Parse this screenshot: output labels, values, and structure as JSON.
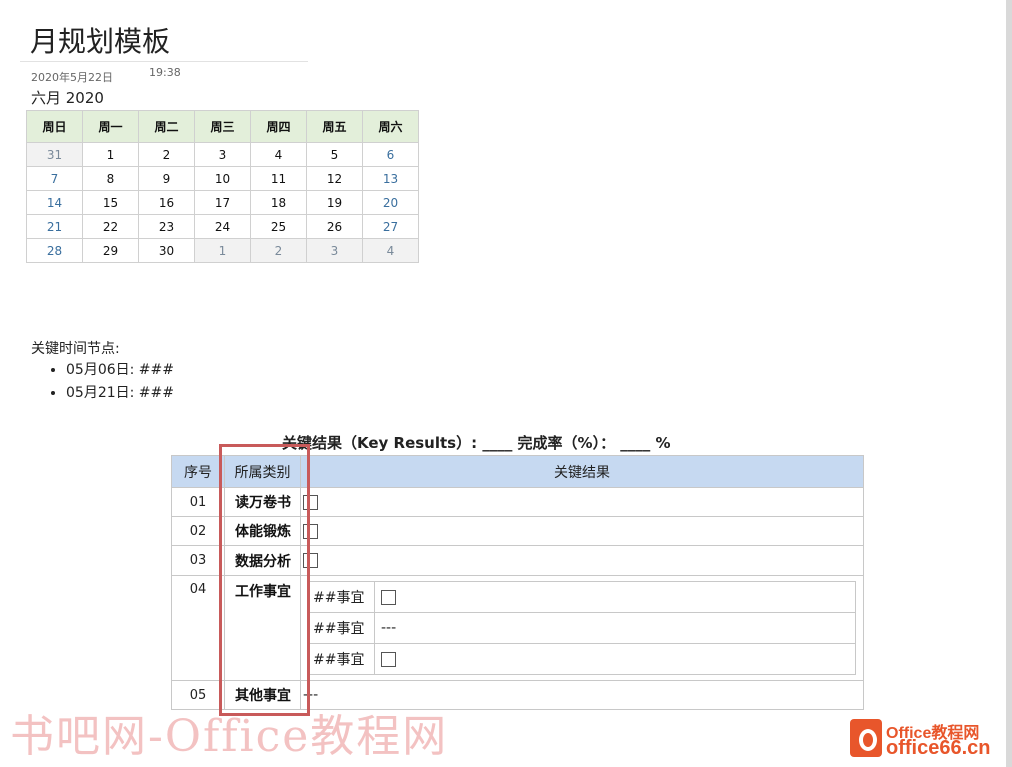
{
  "page": {
    "title": "月规划模板",
    "date": "2020年5月22日",
    "time": "19:38",
    "month": "六月 2020"
  },
  "calendar": {
    "headers": [
      "周日",
      "周一",
      "周二",
      "周三",
      "周四",
      "周五",
      "周六"
    ],
    "weeks": [
      [
        "31",
        "1",
        "2",
        "3",
        "4",
        "5",
        "6"
      ],
      [
        "7",
        "8",
        "9",
        "10",
        "11",
        "12",
        "13"
      ],
      [
        "14",
        "15",
        "16",
        "17",
        "18",
        "19",
        "20"
      ],
      [
        "21",
        "22",
        "23",
        "24",
        "25",
        "26",
        "27"
      ],
      [
        "28",
        "29",
        "30",
        "1",
        "2",
        "3",
        "4"
      ]
    ]
  },
  "key_times": {
    "label": "关键时间节点:",
    "items": [
      "05月06日: ###",
      "05月21日: ###"
    ]
  },
  "key_results": {
    "title": "关键结果（Key Results）:  ____  完成率（%）：   ____ %",
    "headers": [
      "序号",
      "所属类别",
      "关键结果"
    ],
    "rows": [
      {
        "num": "01",
        "cat": "读万卷书"
      },
      {
        "num": "02",
        "cat": "体能锻炼"
      },
      {
        "num": "03",
        "cat": "数据分析"
      },
      {
        "num": "04",
        "cat": "工作事宜"
      },
      {
        "num": "05",
        "cat": "其他事宜",
        "result": "---"
      }
    ],
    "sub_items": [
      {
        "label": "##事宜"
      },
      {
        "label": "##事宜",
        "value": "---"
      },
      {
        "label": "##事宜"
      }
    ]
  },
  "watermark": "书吧网-Office教程网",
  "logo": {
    "top": "Office教程网",
    "bottom": "office66.cn"
  },
  "colors": {
    "calendar_header_bg": "#e3efda",
    "table_header_bg": "#c6d9f1",
    "highlight_border": "#c85a5a",
    "logo_accent": "#e8562b"
  }
}
